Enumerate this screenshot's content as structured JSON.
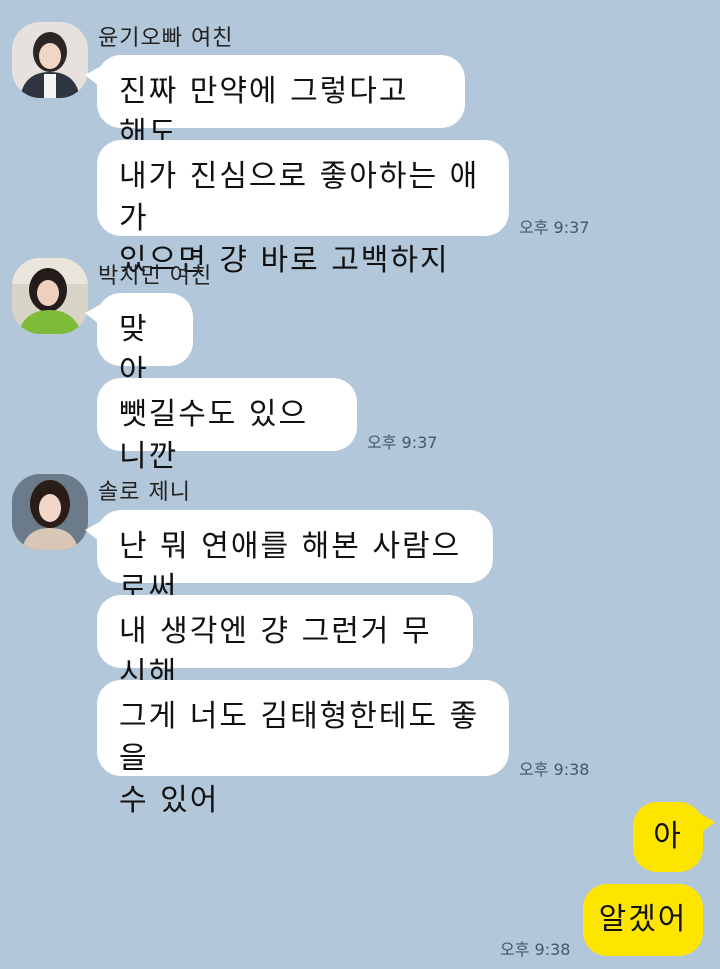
{
  "groups": [
    {
      "sender": "윤기오빠 여친",
      "messages": [
        "진짜 만약에 그렇다고 해도",
        "내가 진심으로 좋아하는 애가\n있으면 걍 바로 고백하지"
      ],
      "time": "오후 9:37"
    },
    {
      "sender": "박지민 여친",
      "messages": [
        "맞아",
        "뺏길수도 있으니깐"
      ],
      "time": "오후 9:37"
    },
    {
      "sender": "솔로 제니",
      "messages": [
        "난 뭐 연애를 해본 사람으로써",
        "내 생각엔 걍 그런거 무시해",
        "그게 너도 김태형한테도 좋을\n수 있어"
      ],
      "time": "오후 9:38"
    }
  ],
  "mine": {
    "messages": [
      "아",
      "알겠어"
    ],
    "time": "오후 9:38"
  },
  "colors": {
    "background": "#b2c7d9",
    "incoming_bubble": "#ffffff",
    "outgoing_bubble": "#fee500"
  }
}
